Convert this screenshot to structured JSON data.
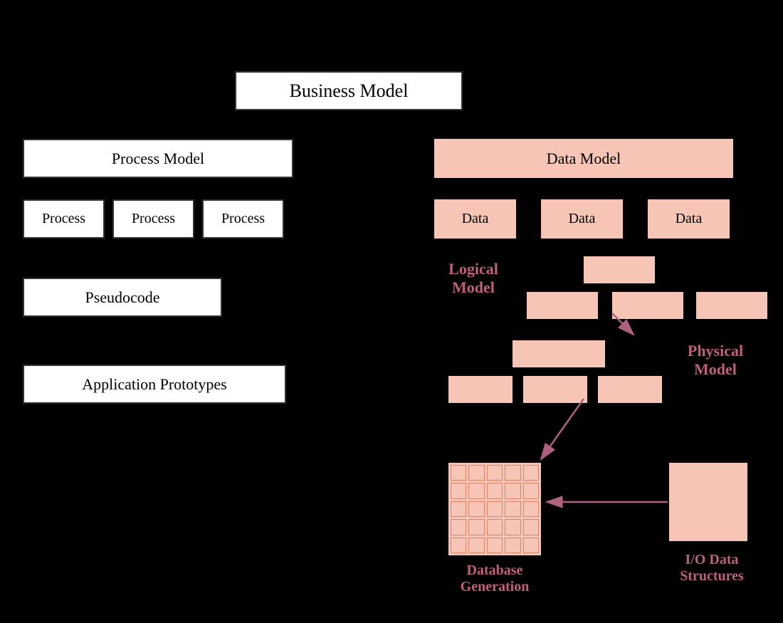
{
  "diagram": {
    "title": "Business Model",
    "left_column": {
      "process_model": "Process Model",
      "processes": [
        "Process",
        "Process",
        "Process"
      ],
      "pseudocode": "Pseudocode",
      "app_prototypes": "Application Prototypes"
    },
    "right_column": {
      "data_model": "Data Model",
      "data_items": [
        "Data",
        "Data",
        "Data"
      ],
      "logical_model_label": "Logical\nModel",
      "physical_model_label": "Physical\nModel",
      "database_generation_label": "Database\nGeneration",
      "io_data_structures_label": "I/O Data\nStructures"
    }
  },
  "colors": {
    "white_box_bg": "#ffffff",
    "white_box_border": "#333333",
    "pink_box_bg": "#f7c5b5",
    "label_color": "#c0607a",
    "background": "#000000",
    "arrow_color": "#b06080"
  }
}
